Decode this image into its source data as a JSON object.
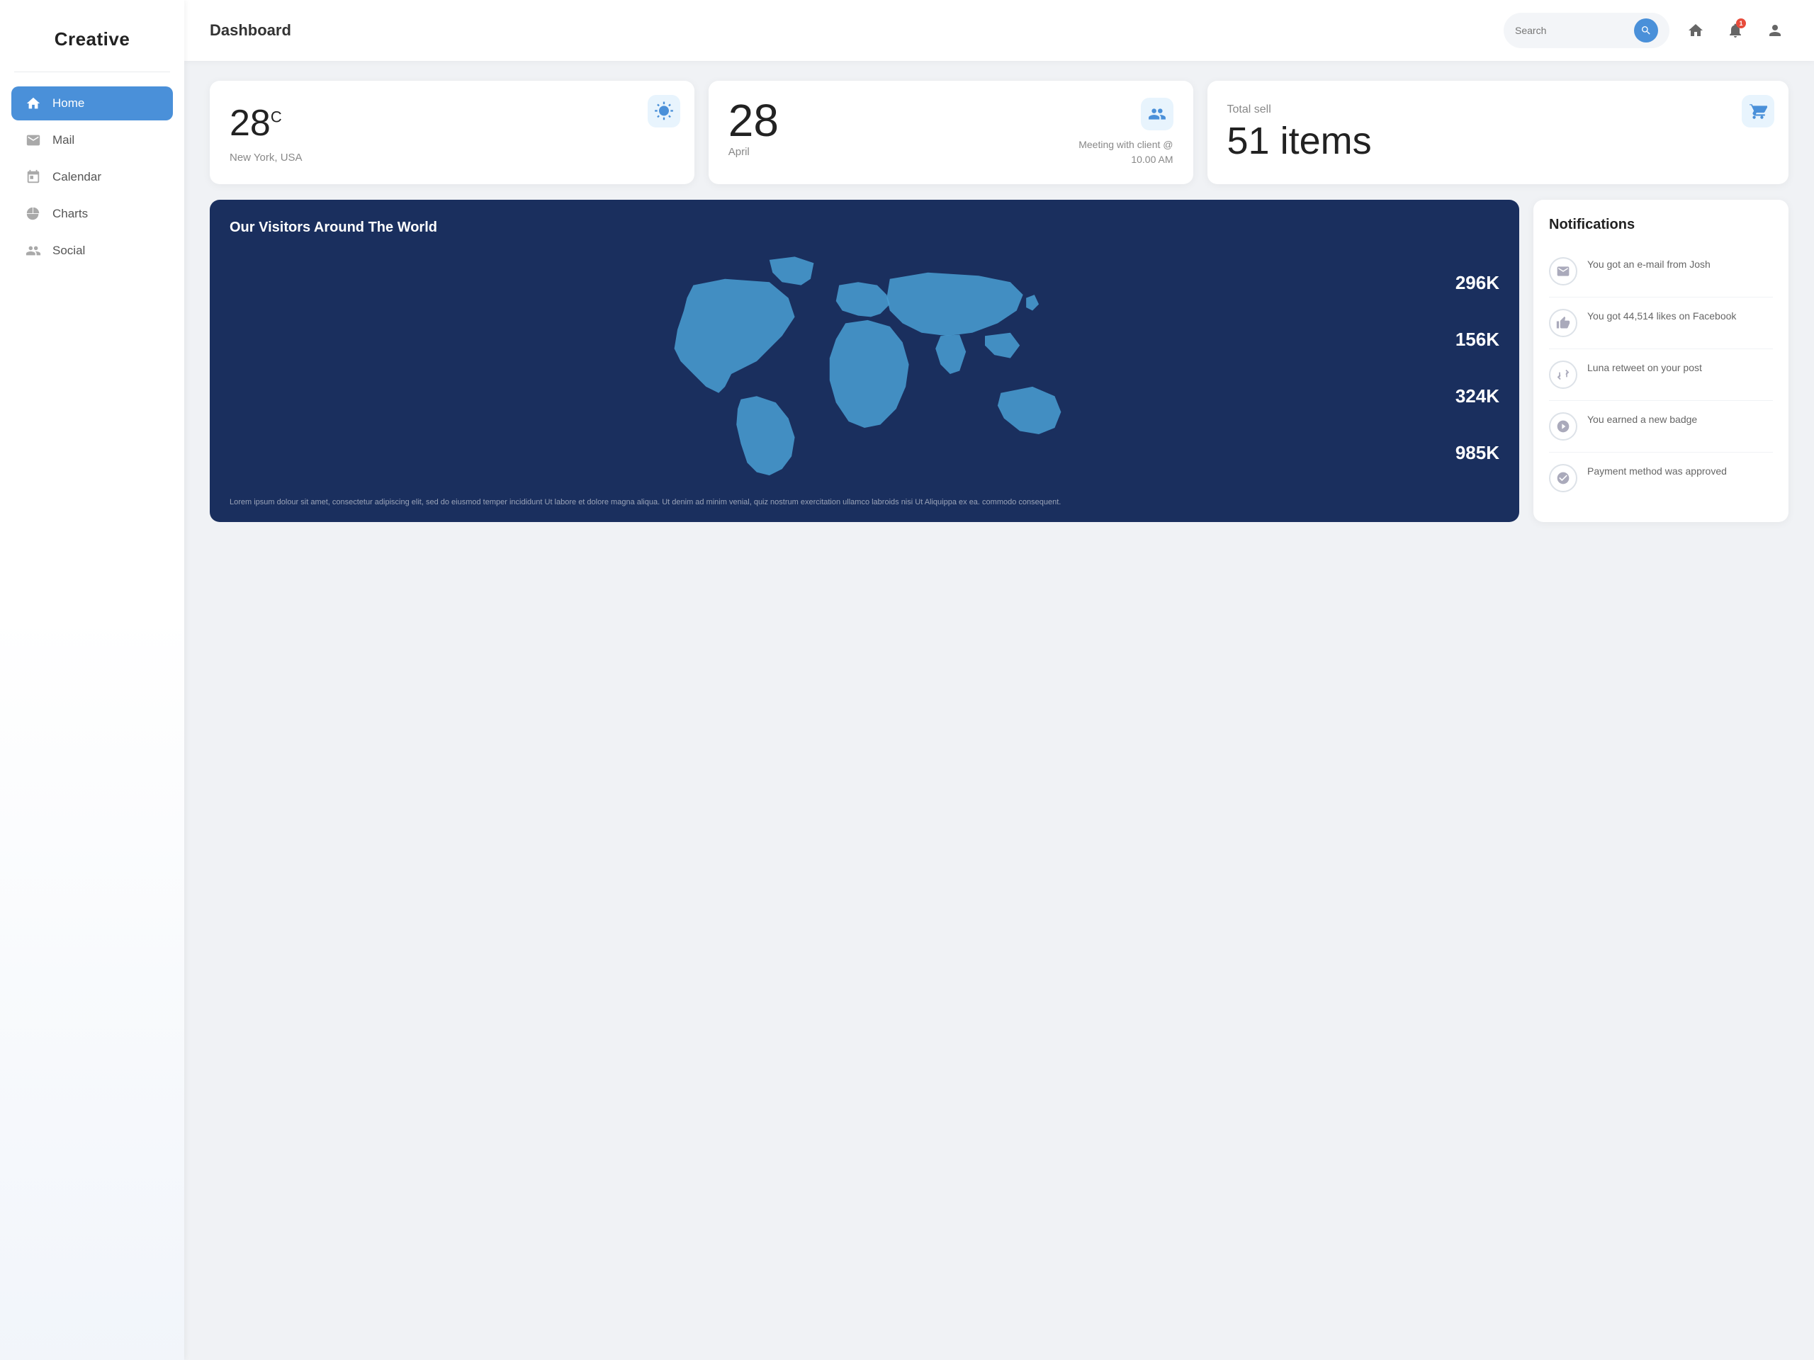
{
  "sidebar": {
    "logo": "Creative",
    "nav_items": [
      {
        "id": "home",
        "label": "Home",
        "icon": "🏠",
        "active": true
      },
      {
        "id": "mail",
        "label": "Mail",
        "icon": "✉",
        "active": false
      },
      {
        "id": "calendar",
        "label": "Calendar",
        "icon": "📅",
        "active": false
      },
      {
        "id": "charts",
        "label": "Charts",
        "icon": "◑",
        "active": false
      },
      {
        "id": "social",
        "label": "Social",
        "icon": "👥",
        "active": false
      }
    ]
  },
  "header": {
    "title": "Dashboard",
    "search_placeholder": "Search",
    "notification_count": "1"
  },
  "weather_card": {
    "icon": "☀",
    "temperature": "28",
    "unit": "C",
    "location": "New York, USA"
  },
  "calendar_card": {
    "icon": "👥",
    "date": "28",
    "month": "April",
    "description": "Meeting with client @ 10.00 AM"
  },
  "sell_card": {
    "icon": "🛒",
    "label": "Total sell",
    "value": "51 items"
  },
  "world_map": {
    "title": "Our Visitors Around The World",
    "stats": [
      "296K",
      "156K",
      "324K",
      "985K"
    ],
    "footer": "Lorem ipsum dolour sit amet, consectetur adipiscing elit, sed do eiusmod temper incididunt Ut labore et dolore magna aliqua. Ut denim ad minim venial, quiz nostrum exercitation ullamco labroids nisi Ut Aliquippa ex ea. commodo consequent."
  },
  "notifications": {
    "title": "Notifications",
    "items": [
      {
        "id": "email",
        "icon": "✉",
        "text": "You got an e-mail from Josh"
      },
      {
        "id": "facebook",
        "icon": "👍",
        "text": "You got 44,514 likes on Facebook"
      },
      {
        "id": "retweet",
        "icon": "⇔",
        "text": "Luna retweet on your post"
      },
      {
        "id": "badge",
        "icon": "🏅",
        "text": "You earned a new badge"
      },
      {
        "id": "payment",
        "icon": "✓",
        "text": "Payment method was approved"
      }
    ]
  }
}
